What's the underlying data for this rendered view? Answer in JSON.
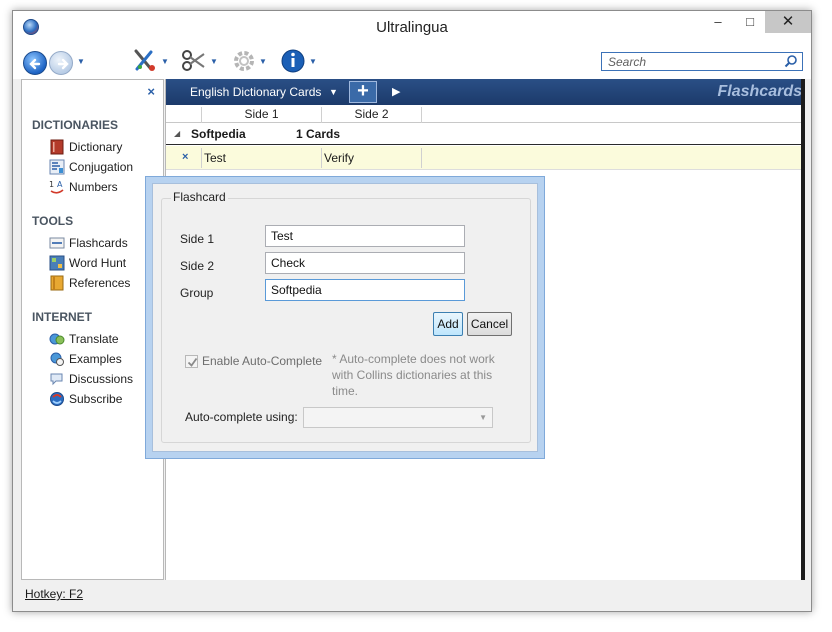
{
  "window": {
    "title": "Ultralingua",
    "minimize": "–",
    "maximize": "□",
    "close": "✕"
  },
  "toolbar": {
    "search_placeholder": "Search",
    "icons": [
      "back-icon",
      "forward-icon",
      "tools-icon",
      "scissors-icon",
      "gear-icon",
      "info-icon"
    ]
  },
  "sidebar": {
    "close": "×",
    "sections": [
      {
        "title": "DICTIONARIES",
        "items": [
          {
            "label": "Dictionary",
            "icon": "book-icon"
          },
          {
            "label": "Conjugation",
            "icon": "conjugation-icon"
          },
          {
            "label": "Numbers",
            "icon": "numbers-icon"
          }
        ]
      },
      {
        "title": "TOOLS",
        "items": [
          {
            "label": "Flashcards",
            "icon": "flashcards-icon"
          },
          {
            "label": "Word Hunt",
            "icon": "word-hunt-icon"
          },
          {
            "label": "References",
            "icon": "references-icon"
          }
        ]
      },
      {
        "title": "INTERNET",
        "items": [
          {
            "label": "Translate",
            "icon": "translate-icon"
          },
          {
            "label": "Examples",
            "icon": "examples-icon"
          },
          {
            "label": "Discussions",
            "icon": "discussions-icon"
          },
          {
            "label": "Subscribe",
            "icon": "subscribe-icon"
          }
        ]
      }
    ]
  },
  "tabbar": {
    "tab_label": "English Dictionary Cards",
    "add": "+",
    "title": "Flashcards"
  },
  "table": {
    "columns": [
      "Side 1",
      "Side 2"
    ],
    "group": {
      "name": "Softpedia",
      "count": "1 Cards"
    },
    "rows": [
      {
        "delete": "×",
        "side1": "Test",
        "side2": "Verify"
      }
    ]
  },
  "dialog": {
    "legend": "Flashcard",
    "side1_label": "Side 1",
    "side1_value": "Test",
    "side2_label": "Side 2",
    "side2_value": "Check",
    "group_label": "Group",
    "group_value": "Softpedia",
    "add_label": "Add",
    "cancel_label": "Cancel",
    "autocomplete_label": "Enable Auto-Complete",
    "autocomplete_checked": true,
    "note": "* Auto-complete does not work with Collins dictionaries at this time.",
    "autocomplete_using_label": "Auto-complete using:"
  },
  "status": {
    "hotkey": "Hotkey: F2"
  }
}
